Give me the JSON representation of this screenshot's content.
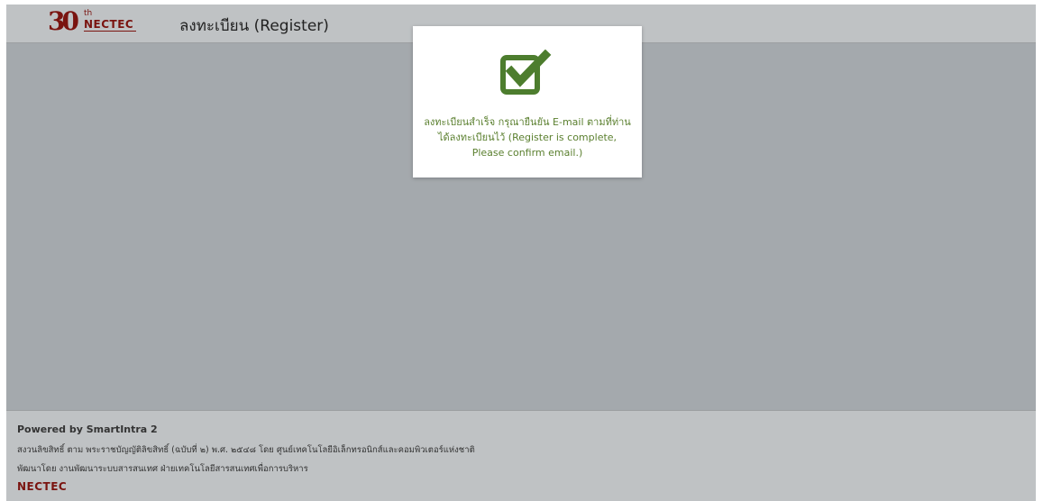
{
  "header": {
    "logo": {
      "number": "30",
      "suffix": "th",
      "brand": "NECTEC"
    },
    "title": "ลงทะเบียน (Register)"
  },
  "dialog": {
    "icon": "check-square-icon",
    "message": "ลงทะเบียนสำเร็จ กรุณายืนยัน E-mail ตามที่ท่านได้ลงทะเบียนไว้ (Register is complete, Please confirm email.)",
    "color": "#4d7d2e"
  },
  "footer": {
    "powered": "Powered by SmartIntra 2",
    "copyright": "สงวนลิขสิทธิ์ ตาม พระราชบัญญัติลิขสิทธิ์ (ฉบับที่ ๒) พ.ศ. ๒๕๔๘ โดย ศูนย์เทคโนโลยีอิเล็กทรอนิกส์และคอมพิวเตอร์แห่งชาติ",
    "developer": "พัฒนาโดย งานพัฒนาระบบสารสนเทศ ฝ่ายเทคโนโลยีสารสนเทศเพื่อการบริหาร",
    "logo_brand": "NECTEC"
  },
  "colors": {
    "backdrop": "#a4a9ad",
    "bar": "#bfc2c4",
    "brand": "#7a1410",
    "success": "#4d7d2e"
  }
}
